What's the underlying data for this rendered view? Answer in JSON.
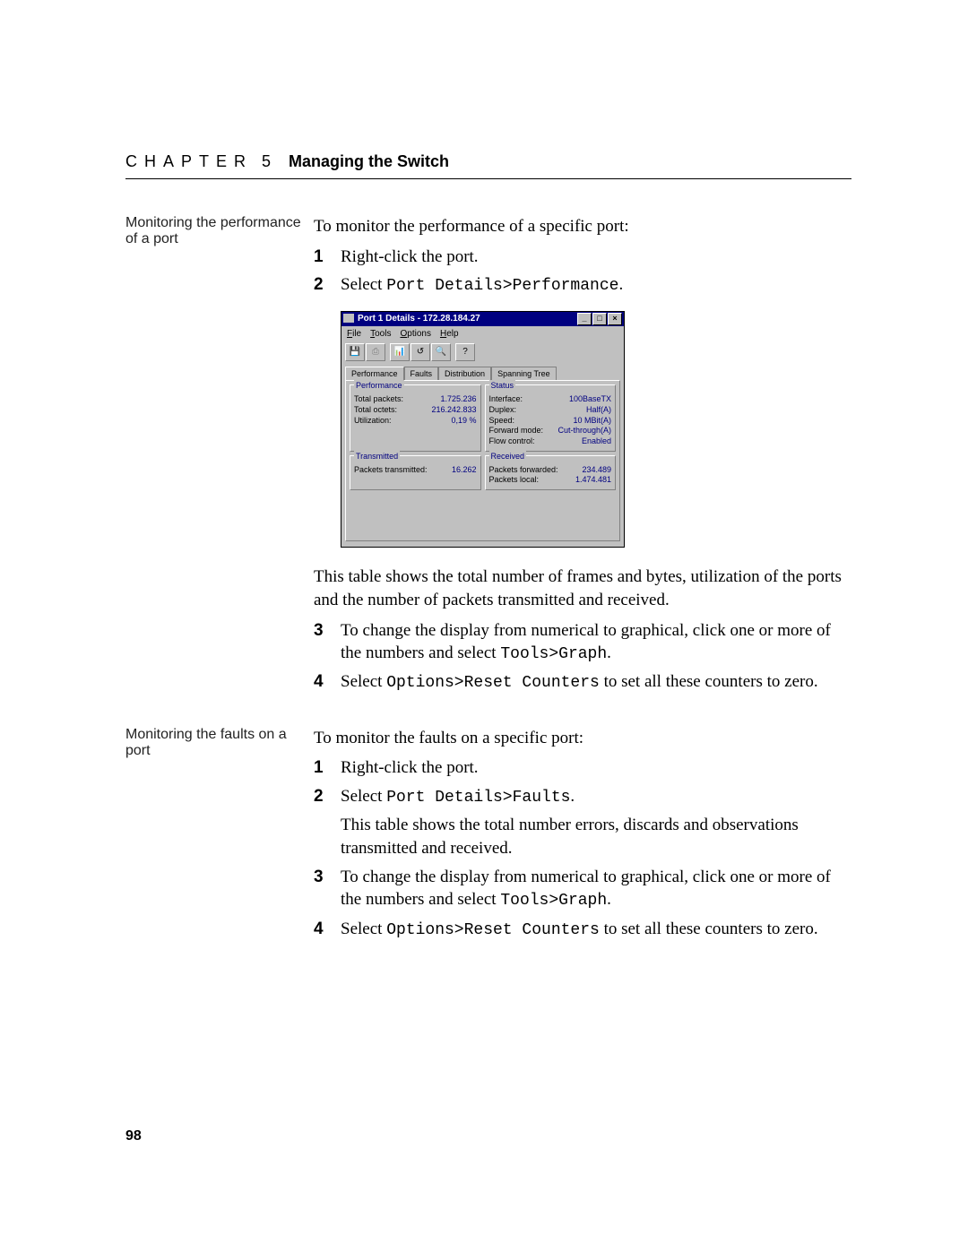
{
  "header": {
    "chapter_label": "CHAPTER",
    "chapter_number": "5",
    "chapter_title": "Managing the Switch"
  },
  "section1": {
    "margin_note": "Monitoring the performance of a port",
    "intro": "To monitor the performance of a specific port:",
    "steps": [
      {
        "num": "1",
        "text": "Right-click the port."
      },
      {
        "num": "2",
        "prefix": "Select ",
        "code": "Port Details>Performance",
        "suffix": "."
      }
    ],
    "after_screenshot": "This table shows the total number of frames and bytes, utilization of the ports and the number of packets transmitted and received.",
    "steps2": [
      {
        "num": "3",
        "prefix": "To change the display from numerical to graphical, click one or more of the numbers and select ",
        "code": "Tools>Graph",
        "suffix": "."
      },
      {
        "num": "4",
        "prefix": "Select ",
        "code": "Options>Reset Counters",
        "suffix": " to set all these counters to zero."
      }
    ]
  },
  "screenshot": {
    "title": "Port 1 Details - 172.28.184.27",
    "menus": [
      "File",
      "Tools",
      "Options",
      "Help"
    ],
    "tabs": [
      "Performance",
      "Faults",
      "Distribution",
      "Spanning Tree"
    ],
    "performance": {
      "legend": "Performance",
      "rows": [
        {
          "k": "Total packets:",
          "v": "1.725.236"
        },
        {
          "k": "Total octets:",
          "v": "216.242.833"
        },
        {
          "k": "Utilization:",
          "v": "0,19 %"
        }
      ]
    },
    "status": {
      "legend": "Status",
      "rows": [
        {
          "k": "Interface:",
          "v": "100BaseTX"
        },
        {
          "k": "Duplex:",
          "v": "Half(A)"
        },
        {
          "k": "Speed:",
          "v": "10 MBit(A)"
        },
        {
          "k": "Forward mode:",
          "v": "Cut-through(A)"
        },
        {
          "k": "Flow control:",
          "v": "Enabled"
        }
      ]
    },
    "transmitted": {
      "legend": "Transmitted",
      "rows": [
        {
          "k": "Packets transmitted:",
          "v": "16.262"
        }
      ]
    },
    "received": {
      "legend": "Received",
      "rows": [
        {
          "k": "Packets forwarded:",
          "v": "234.489"
        },
        {
          "k": "Packets local:",
          "v": "1.474.481"
        }
      ]
    }
  },
  "section2": {
    "margin_note": "Monitoring the faults on a port",
    "intro": "To monitor the faults on a specific port:",
    "steps": [
      {
        "num": "1",
        "text": "Right-click the port."
      },
      {
        "num": "2",
        "prefix": "Select ",
        "code": "Port Details>Faults",
        "suffix": ".",
        "after": "This table shows the total number errors, discards and observations transmitted and received."
      },
      {
        "num": "3",
        "prefix": "To change the display from numerical to graphical, click one or more of the numbers and select ",
        "code": "Tools>Graph",
        "suffix": "."
      },
      {
        "num": "4",
        "prefix": "Select ",
        "code": "Options>Reset Counters",
        "suffix": " to set all these counters to zero."
      }
    ]
  },
  "page_number": "98"
}
